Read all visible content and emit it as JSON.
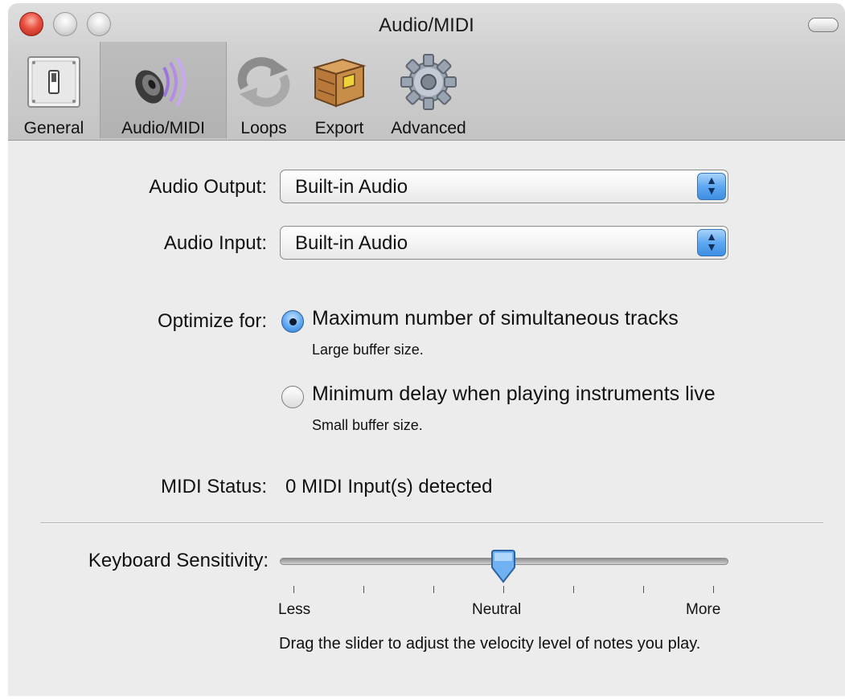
{
  "window": {
    "title": "Audio/MIDI"
  },
  "toolbar": {
    "items": [
      {
        "label": "General",
        "icon": "switch-icon",
        "selected": false
      },
      {
        "label": "Audio/MIDI",
        "icon": "speaker-icon",
        "selected": true
      },
      {
        "label": "Loops",
        "icon": "loop-arrows-icon",
        "selected": false
      },
      {
        "label": "Export",
        "icon": "box-icon",
        "selected": false
      },
      {
        "label": "Advanced",
        "icon": "gear-icon",
        "selected": false
      }
    ]
  },
  "audio_output": {
    "label": "Audio Output:",
    "value": "Built-in Audio"
  },
  "audio_input": {
    "label": "Audio Input:",
    "value": "Built-in Audio"
  },
  "optimize": {
    "label": "Optimize for:",
    "options": [
      {
        "title": "Maximum number of simultaneous tracks",
        "subtitle": "Large buffer size.",
        "checked": true
      },
      {
        "title": "Minimum delay when playing instruments live",
        "subtitle": "Small buffer size.",
        "checked": false
      }
    ]
  },
  "midi_status": {
    "label": "MIDI Status:",
    "value": "0 MIDI Input(s) detected"
  },
  "keyboard_sensitivity": {
    "label": "Keyboard Sensitivity:",
    "value_fraction": 0.5,
    "tick_count": 7,
    "min_label": "Less",
    "mid_label": "Neutral",
    "max_label": "More",
    "help": "Drag the slider to adjust the velocity level of notes you play."
  },
  "colors": {
    "accent": "#5ea8f1",
    "window_bg": "#ececec",
    "close": "#e84f3f"
  }
}
